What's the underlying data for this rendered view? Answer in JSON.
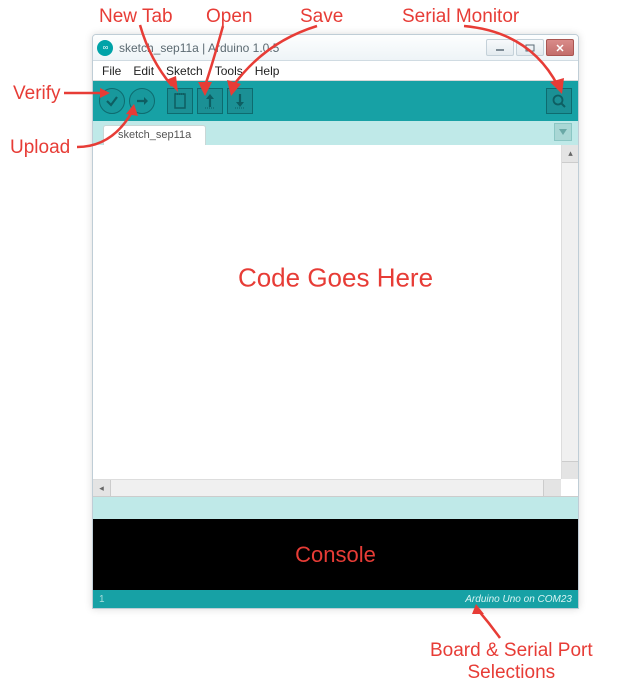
{
  "annotations": {
    "new_tab": "New Tab",
    "open": "Open",
    "save": "Save",
    "serial_monitor": "Serial Monitor",
    "verify": "Verify",
    "upload": "Upload",
    "code_goes_here": "Code Goes Here",
    "console": "Console",
    "board_serial_line1": "Board & Serial Port",
    "board_serial_line2": "Selections"
  },
  "titlebar": {
    "icon_text": "∞",
    "title": "sketch_sep11a | Arduino 1.0.5"
  },
  "menubar": {
    "items": [
      "File",
      "Edit",
      "Sketch",
      "Tools",
      "Help"
    ]
  },
  "toolbar": {
    "verify_tooltip": "Verify",
    "upload_tooltip": "Upload",
    "new_tooltip": "New",
    "open_tooltip": "Open",
    "save_tooltip": "Save",
    "serial_tooltip": "Serial Monitor"
  },
  "tabs": {
    "active": "sketch_sep11a"
  },
  "footer": {
    "line": "1",
    "board": "Arduino Uno on COM23"
  }
}
